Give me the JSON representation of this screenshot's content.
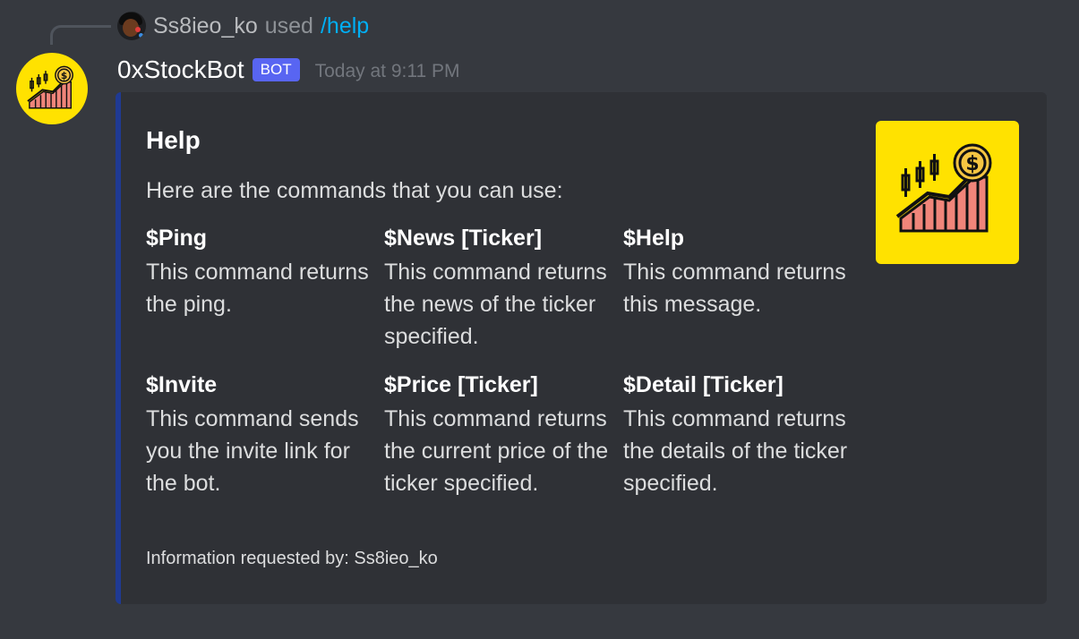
{
  "reply": {
    "username": "Ss8ieo_ko",
    "used_text": "used",
    "command": "/help"
  },
  "message": {
    "bot_name": "0xStockBot",
    "bot_tag": "BOT",
    "timestamp": "Today at 9:11 PM"
  },
  "embed": {
    "accent_color": "#1f3a93",
    "title": "Help",
    "description": "Here are the commands that you can use:",
    "fields": [
      {
        "name": "$Ping",
        "value": "This command returns the ping."
      },
      {
        "name": "$News [Ticker]",
        "value": "This command returns the news of the ticker specified."
      },
      {
        "name": "$Help",
        "value": "This command returns this message."
      },
      {
        "name": "$Invite",
        "value": "This command sends you the invite link for the bot."
      },
      {
        "name": "$Price [Ticker]",
        "value": "This command returns the current price of the ticker specified."
      },
      {
        "name": "$Detail [Ticker]",
        "value": "This command returns the details of the ticker specified."
      }
    ],
    "footer": "Information requested by: Ss8ieo_ko",
    "thumbnail_icon": "stock-growth-coin-icon"
  },
  "colors": {
    "background": "#36393f",
    "embed_background": "#2f3136",
    "bot_tag": "#5865f2",
    "command_link": "#00aff4",
    "logo_yellow": "#ffe200"
  }
}
